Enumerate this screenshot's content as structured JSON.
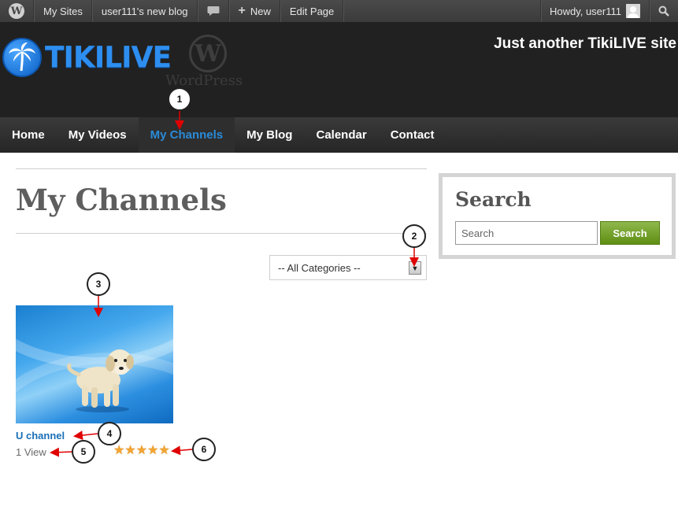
{
  "admin_bar": {
    "wp_logo_icon": "wordpress-icon",
    "my_sites": "My Sites",
    "blog_name": "user111's new blog",
    "comments_icon": "comment-icon",
    "new_label": "New",
    "edit_page": "Edit Page",
    "howdy": "Howdy, user111",
    "search_icon": "search-icon"
  },
  "header": {
    "logo_text": "TIKILIVE",
    "wordpress_logo_text": "WordPress",
    "tagline": "Just another TikiLIVE site"
  },
  "nav": {
    "items": [
      {
        "label": "Home"
      },
      {
        "label": "My Videos"
      },
      {
        "label": "My Channels",
        "active": true
      },
      {
        "label": "My Blog"
      },
      {
        "label": "Calendar"
      },
      {
        "label": "Contact"
      }
    ]
  },
  "main": {
    "title": "My Channels",
    "category_select": "-- All Categories --",
    "channel": {
      "title": "U channel",
      "views": "1 View",
      "rating": 5,
      "rating_max": 5
    }
  },
  "sidebar": {
    "search_title": "Search",
    "search_placeholder": "Search",
    "search_button": "Search"
  },
  "callouts": [
    "1",
    "2",
    "3",
    "4",
    "5",
    "6"
  ],
  "colors": {
    "accent": "#2a8bd8",
    "link": "#1a6fb8",
    "search_button": "#6b9a1c",
    "star": "#f2a531",
    "arrow": "#e00000"
  }
}
